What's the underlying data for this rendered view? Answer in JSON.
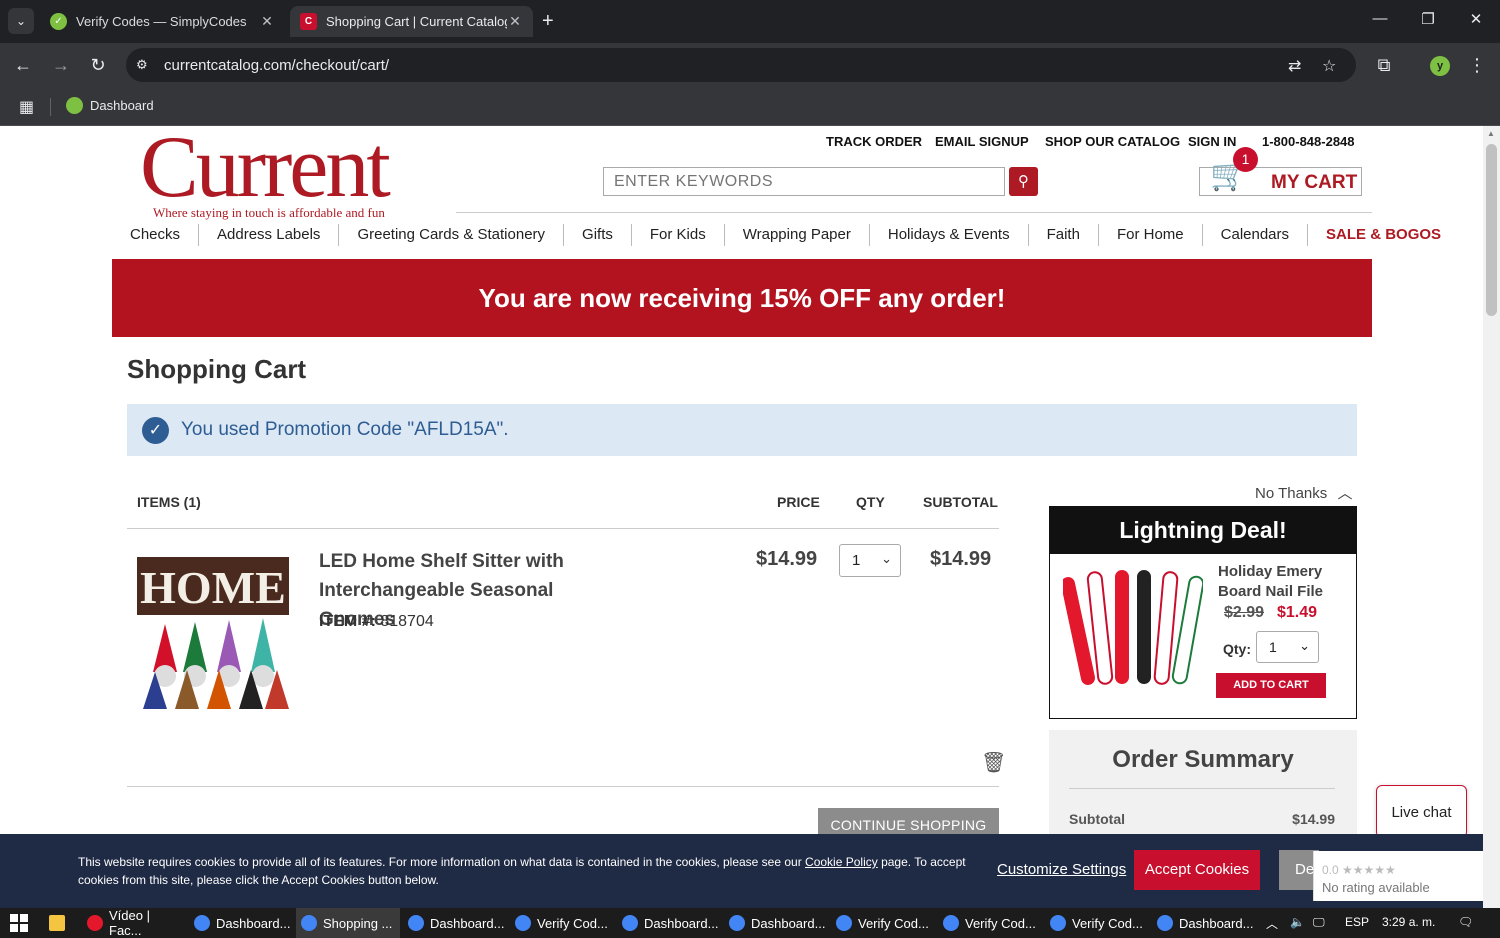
{
  "browser": {
    "tabs": [
      {
        "title": "Verify Codes — SimplyCodes",
        "active": false
      },
      {
        "title": "Shopping Cart | Current Catalog",
        "active": true
      }
    ],
    "url": "currentcatalog.com/checkout/cart/",
    "bookmarks": [
      {
        "label": "Dashboard"
      }
    ],
    "profile_initial": "y"
  },
  "site": {
    "logo_word": "Current",
    "logo_tagline": "Where staying in touch is affordable and fun",
    "top_links": [
      "TRACK ORDER",
      "EMAIL SIGNUP",
      "SHOP OUR CATALOG",
      "SIGN IN",
      "1-800-848-2848"
    ],
    "search_placeholder": "ENTER KEYWORDS",
    "cart_label": "MY CART",
    "cart_count": "1",
    "nav": [
      "Checks",
      "Address Labels",
      "Greeting Cards & Stationery",
      "Gifts",
      "For Kids",
      "Wrapping Paper",
      "Holidays & Events",
      "Faith",
      "For Home",
      "Calendars",
      "SALE & BOGOS"
    ],
    "brand_color": "#ad1a23"
  },
  "banner": {
    "text": "You are now receiving 15% OFF any order!"
  },
  "cart": {
    "title": "Shopping Cart",
    "promo_message": "You used Promotion Code \"AFLD15A\".",
    "headers": {
      "items": "ITEMS (1)",
      "price": "PRICE",
      "qty": "QTY",
      "subtotal": "SUBTOTAL"
    },
    "item": {
      "name": "LED Home Shelf Sitter with Interchangeable Seasonal Gnomes",
      "item_label": "ITEM #:",
      "item_number": "818704",
      "price": "$14.99",
      "qty": "1",
      "subtotal": "$14.99",
      "image_text": "HOME"
    },
    "continue_label": "CONTINUE SHOPPING"
  },
  "deal": {
    "no_thanks": "No Thanks",
    "title": "Lightning Deal!",
    "name": "Holiday Emery Board Nail File",
    "old_price": "$2.99",
    "new_price": "$1.49",
    "qty_label": "Qty:",
    "qty": "1",
    "add_label": "ADD TO CART"
  },
  "summary": {
    "title": "Order Summary",
    "subtotal_label": "Subtotal",
    "subtotal_value": "$14.99"
  },
  "livechat": "Live chat",
  "cookie": {
    "text_part1": "This website requires cookies to provide all of its features. For more information on what data is contained in the cookies, please see our ",
    "link": "Cookie Policy",
    "text_part2": " page. To accept cookies from this site, please click the Accept Cookies button below.",
    "customize": "Customize Settings",
    "accept": "Accept Cookies",
    "decline": "De"
  },
  "rating": {
    "score": "0.0 ★★★★★",
    "text": "No rating available"
  },
  "taskbar": {
    "items": [
      "Vídeo | Fac...",
      "Dashboard...",
      "Shopping ...",
      "Dashboard...",
      "Verify Cod...",
      "Dashboard...",
      "Dashboard...",
      "Verify Cod...",
      "Verify Cod...",
      "Verify Cod...",
      "Dashboard..."
    ],
    "lang": "ESP",
    "time": "3:29 a. m."
  }
}
